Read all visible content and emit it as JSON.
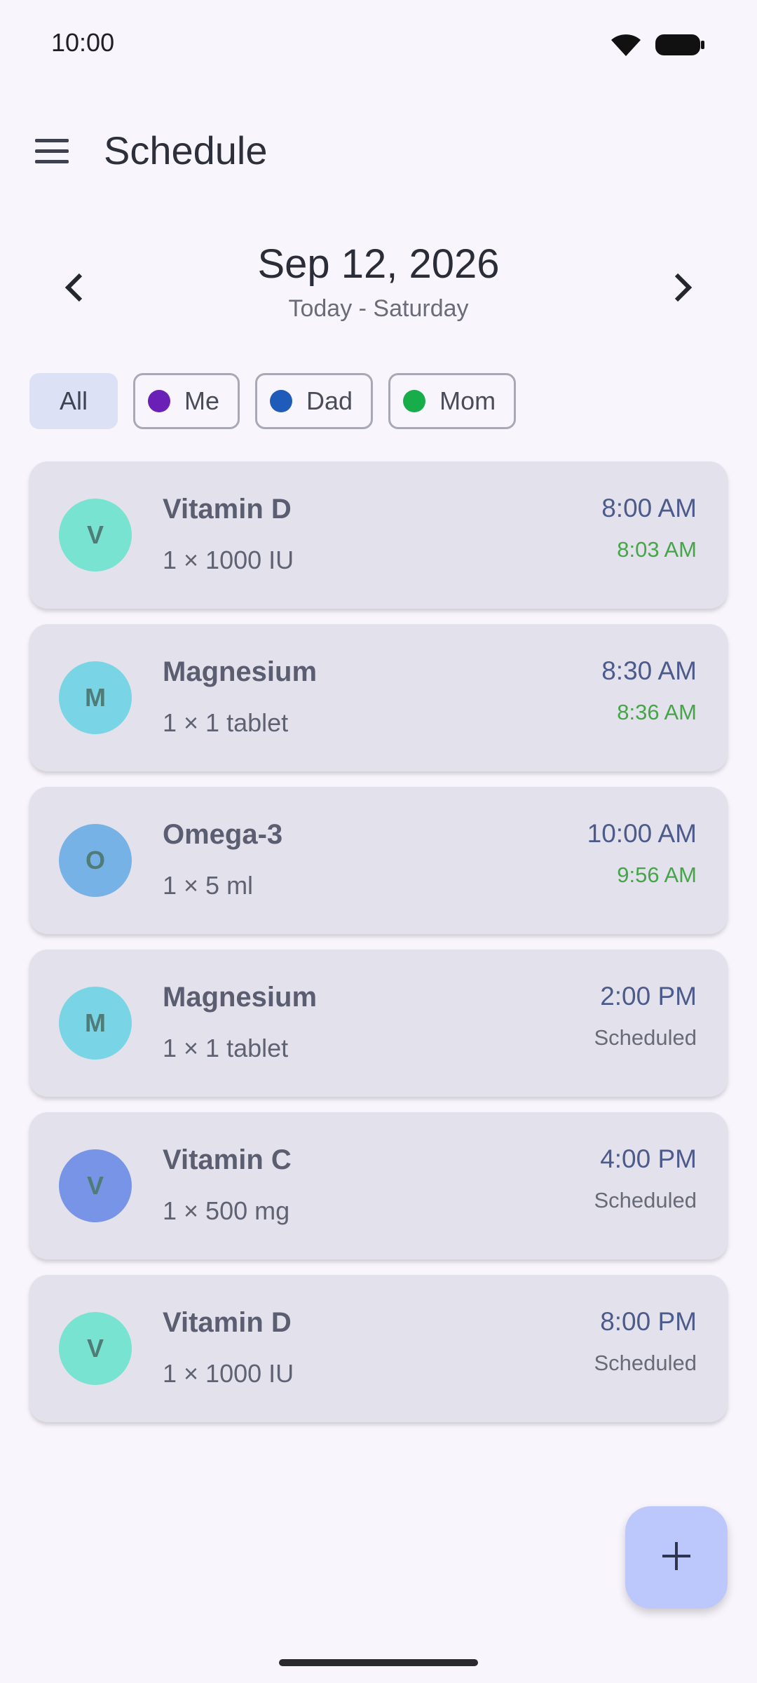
{
  "status_bar": {
    "time": "10:00",
    "wifi_icon": "wifi-icon",
    "battery_icon": "battery-icon"
  },
  "app_bar": {
    "title": "Schedule",
    "menu_icon": "menu-icon"
  },
  "date_nav": {
    "date": "Sep 12, 2026",
    "subtitle": "Today - Saturday",
    "prev_icon": "chevron-left-icon",
    "next_icon": "chevron-right-icon"
  },
  "filters": [
    {
      "label": "All",
      "selected": true,
      "color": null
    },
    {
      "label": "Me",
      "selected": false,
      "color": "#6a1fb6"
    },
    {
      "label": "Dad",
      "selected": false,
      "color": "#1f5bb8"
    },
    {
      "label": "Mom",
      "selected": false,
      "color": "#17ad4a"
    }
  ],
  "schedule": [
    {
      "initial": "V",
      "name": "Vitamin D",
      "dose": "1 × 1000 IU",
      "time": "8:00 AM",
      "status": "8:03 AM",
      "status_type": "taken",
      "color": "#79e3d1"
    },
    {
      "initial": "M",
      "name": "Magnesium",
      "dose": "1 × 1 tablet",
      "time": "8:30 AM",
      "status": "8:36 AM",
      "status_type": "taken",
      "color": "#79d5e6"
    },
    {
      "initial": "O",
      "name": "Omega-3",
      "dose": "1 × 5 ml",
      "time": "10:00 AM",
      "status": "9:56 AM",
      "status_type": "taken",
      "color": "#76b2e5"
    },
    {
      "initial": "M",
      "name": "Magnesium",
      "dose": "1 × 1 tablet",
      "time": "2:00 PM",
      "status": "Scheduled",
      "status_type": "scheduled",
      "color": "#79d5e6"
    },
    {
      "initial": "V",
      "name": "Vitamin C",
      "dose": "1 × 500 mg",
      "time": "4:00 PM",
      "status": "Scheduled",
      "status_type": "scheduled",
      "color": "#7894e6"
    },
    {
      "initial": "V",
      "name": "Vitamin D",
      "dose": "1 × 1000 IU",
      "time": "8:00 PM",
      "status": "Scheduled",
      "status_type": "scheduled",
      "color": "#79e3d1"
    }
  ],
  "fab": {
    "icon": "plus-icon"
  }
}
